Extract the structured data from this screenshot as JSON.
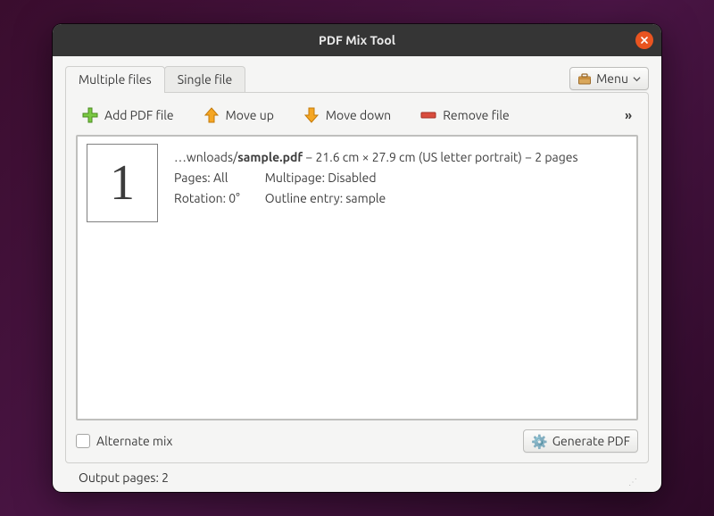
{
  "window": {
    "title": "PDF Mix Tool"
  },
  "tabs": {
    "multiple": "Multiple files",
    "single": "Single file"
  },
  "menu": {
    "label": "Menu"
  },
  "toolbar": {
    "add": "Add PDF file",
    "up": "Move up",
    "down": "Move down",
    "remove": "Remove file",
    "overflow": "»"
  },
  "file": {
    "thumb": "1",
    "path_prefix": "…wnloads/",
    "filename": "sample.pdf",
    "dims": " − 21.6 cm × 27.9 cm (US letter portrait) − 2 pages",
    "pages_lbl": "Pages: ",
    "pages_val": "All",
    "rotation_lbl": "Rotation: ",
    "rotation_val": "0°",
    "multipage_lbl": "Multipage: ",
    "multipage_val": "Disabled",
    "outline_lbl": "Outline entry: ",
    "outline_val": "sample"
  },
  "bottom": {
    "alternate": "Alternate mix",
    "generate": "Generate PDF"
  },
  "status": {
    "output": "Output pages: 2"
  }
}
